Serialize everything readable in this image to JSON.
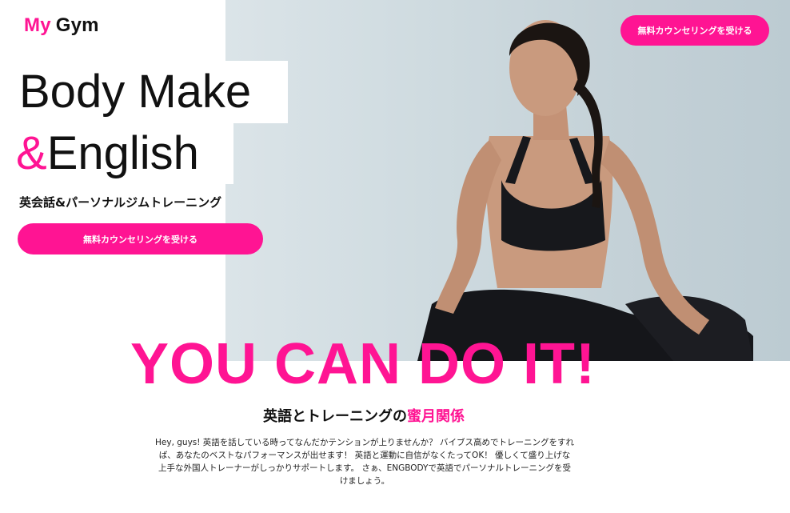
{
  "header": {
    "logo_my": "My",
    "logo_gym": "Gym",
    "cta_label": "無料カウンセリングを受ける"
  },
  "hero": {
    "headline_line1": "Body Make",
    "headline_amp": "&",
    "headline_line2": "English",
    "subtitle": "英会話&パーソナルジムトレーニング",
    "cta_label": "無料カウンセリングを受ける",
    "photo_icon": "woman-sitting-photo"
  },
  "slogan": "YOU CAN DO IT!",
  "section": {
    "title_prefix": "英語とトレーニングの",
    "title_accent": "蜜月関係",
    "intro": "Hey, guys! 英語を話している時ってなんだかテンションが上りませんか？ バイブス高めでトレーニングをすれば、あなたのベストなパフォーマンスが出せます！ 英語と運動に自信がなくたってOK！ 優しくて盛り上げな上手な外国人トレーナーがしっかりサポートします。 さぁ、ENGBODYで英語でパーソナルトレーニングを受けましょう。"
  },
  "colors": {
    "accent": "#ff1493",
    "text": "#111111",
    "photo_bg": "#cfdbe0"
  }
}
